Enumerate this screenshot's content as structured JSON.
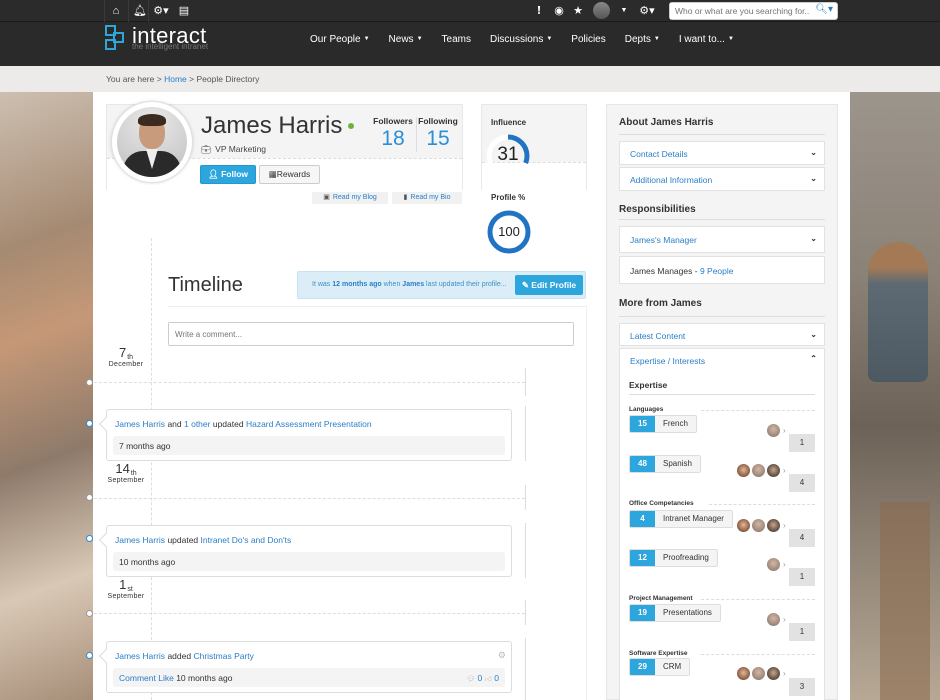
{
  "topbar": {
    "left_icons": [
      "home-icon",
      "bell-icon",
      "gear-dropdown-icon",
      "document-icon"
    ],
    "right_icons": [
      "alert-icon",
      "eye-icon",
      "star-icon"
    ],
    "search_placeholder": "Who or what are you searching for..."
  },
  "brand": {
    "name": "interact",
    "tagline": "the intelligent intranet",
    "accent": "#2fa6d9"
  },
  "nav": [
    {
      "label": "Our People",
      "dropdown": true
    },
    {
      "label": "News",
      "dropdown": true
    },
    {
      "label": "Teams",
      "dropdown": false
    },
    {
      "label": "Discussions",
      "dropdown": true
    },
    {
      "label": "Policies",
      "dropdown": false
    },
    {
      "label": "Depts",
      "dropdown": true
    },
    {
      "label": "I want to...",
      "dropdown": true
    }
  ],
  "breadcrumb": {
    "prefix": "You are here >",
    "home": "Home",
    "sep": ">",
    "current": "People Directory"
  },
  "profile": {
    "name": "James Harris",
    "job_title": "VP Marketing",
    "followers_label": "Followers",
    "followers": "18",
    "following_label": "Following",
    "following": "15",
    "follow_btn": "Follow",
    "rewards_btn": "Rewards",
    "blog_link": "Read my Blog",
    "bio_link": "Read my Bio"
  },
  "influence": {
    "label": "Influence",
    "value": "31",
    "percent": 31
  },
  "profile_pct": {
    "label": "Profile %",
    "value": "100",
    "percent": 100
  },
  "timeline": {
    "title": "Timeline",
    "notice_pre": "It was",
    "notice_age": "12 months ago",
    "notice_mid": "when",
    "notice_name": "James",
    "notice_post": "last updated their profile...",
    "edit_btn": "Edit Profile",
    "comment_placeholder": "Write a comment...",
    "dates": [
      {
        "day": "7",
        "suffix": "th",
        "month": "December"
      },
      {
        "day": "14",
        "suffix": "th",
        "month": "September"
      },
      {
        "day": "1",
        "suffix": "st",
        "month": "September"
      }
    ],
    "activities": [
      {
        "actor": "James Harris",
        "mid1": "and",
        "other": "1 other",
        "verb": "updated",
        "object": "Hazard Assessment Presentation",
        "time": "7 months ago"
      },
      {
        "actor": "James Harris",
        "verb": "updated",
        "object": "Intranet Do's and Don'ts",
        "time": "10 months ago"
      },
      {
        "actor": "James Harris",
        "verb": "added",
        "object": "Christmas Party",
        "comment": "Comment",
        "like": "Like",
        "time": "10 months ago",
        "comments_count": "0",
        "likes_count": "0"
      }
    ]
  },
  "sidebar": {
    "about_title": "About James Harris",
    "contact": "Contact Details",
    "additional": "Additional Information",
    "resp_title": "Responsibilities",
    "manager": "James's Manager",
    "manages_pre": "James Manages -",
    "manages_link": "9 People",
    "more_title": "More from James",
    "latest": "Latest Content",
    "expertise_tab": "Expertise / Interests",
    "expertise_head": "Expertise",
    "categories": [
      {
        "name": "Languages",
        "skills": [
          {
            "count": "15",
            "name": "French",
            "endorsers": 1,
            "total": "1"
          },
          {
            "count": "48",
            "name": "Spanish",
            "endorsers": 3,
            "total": "4"
          }
        ]
      },
      {
        "name": "Office Competancies",
        "skills": [
          {
            "count": "4",
            "name": "Intranet Manager",
            "endorsers": 3,
            "total": "4"
          },
          {
            "count": "12",
            "name": "Proofreading",
            "endorsers": 1,
            "total": "1"
          }
        ]
      },
      {
        "name": "Project Management",
        "skills": [
          {
            "count": "19",
            "name": "Presentations",
            "endorsers": 1,
            "total": "1"
          }
        ]
      },
      {
        "name": "Software Expertise",
        "skills": [
          {
            "count": "29",
            "name": "CRM",
            "endorsers": 3,
            "total": "3"
          }
        ]
      }
    ]
  }
}
